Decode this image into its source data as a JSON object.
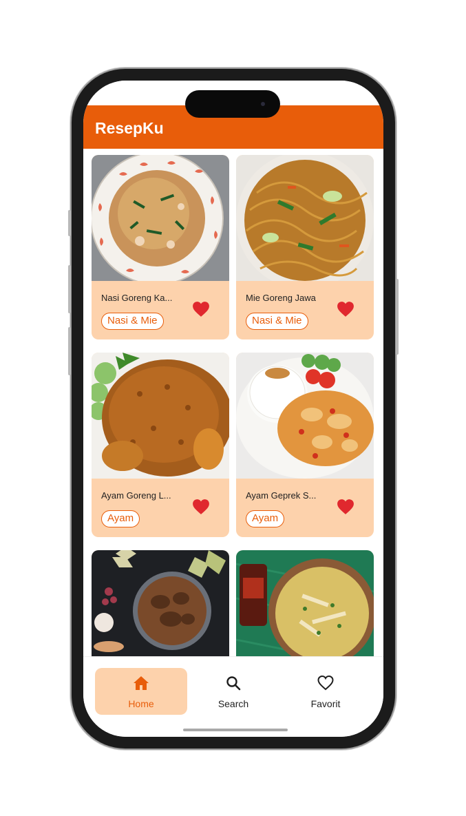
{
  "app": {
    "title": "ResepKu"
  },
  "recipes": [
    {
      "name": "Nasi Goreng Ka...",
      "category": "Nasi & Mie",
      "favorite": true
    },
    {
      "name": "Mie Goreng Jawa",
      "category": "Nasi & Mie",
      "favorite": true
    },
    {
      "name": "Ayam Goreng L...",
      "category": "Ayam",
      "favorite": true
    },
    {
      "name": "Ayam Geprek S...",
      "category": "Ayam",
      "favorite": true
    },
    {
      "name": "",
      "category": "",
      "favorite": false
    },
    {
      "name": "",
      "category": "",
      "favorite": false
    }
  ],
  "nav": {
    "items": [
      {
        "label": "Home",
        "icon": "home-icon",
        "active": true
      },
      {
        "label": "Search",
        "icon": "search-icon",
        "active": false
      },
      {
        "label": "Favorit",
        "icon": "heart-outline-icon",
        "active": false
      }
    ]
  },
  "colors": {
    "primary": "#e85d0a",
    "card": "#fdd2ac",
    "heart": "#e0282e"
  }
}
